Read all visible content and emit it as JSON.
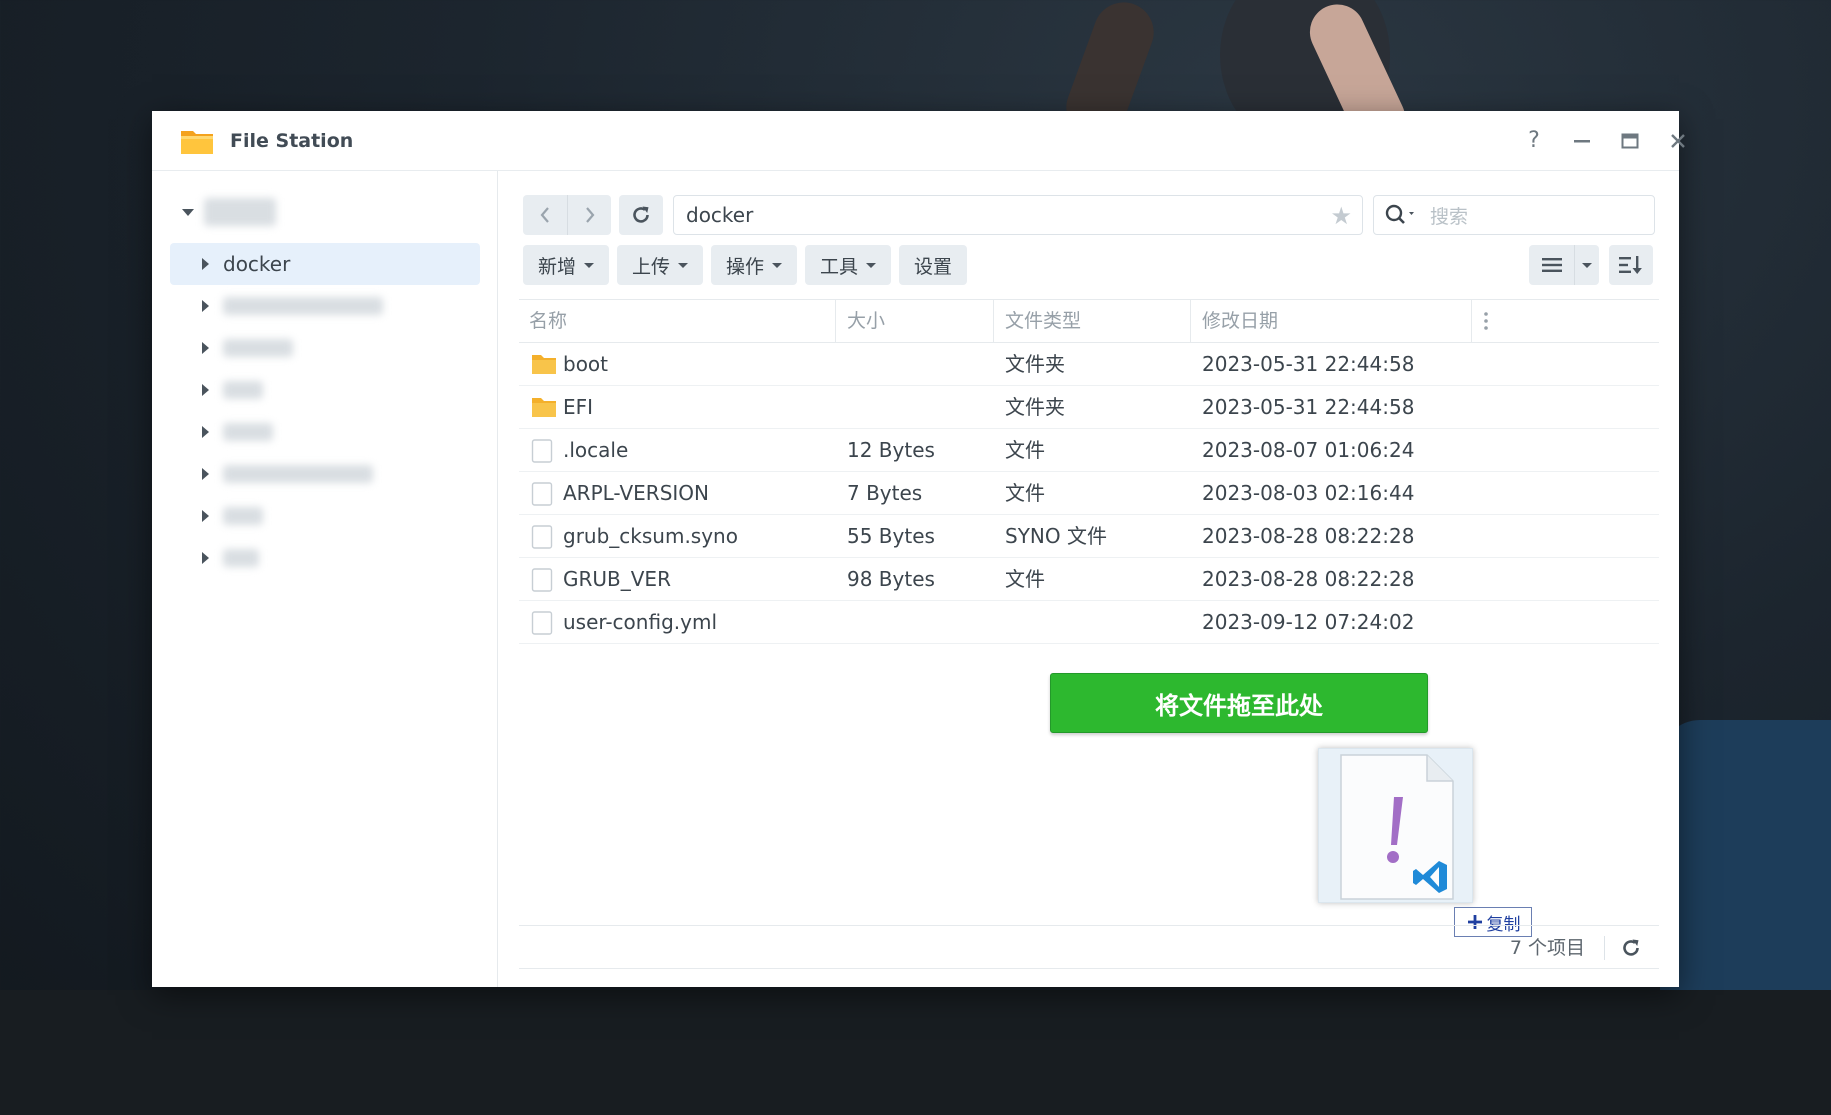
{
  "window": {
    "title": "File Station",
    "help_label": "?",
    "minimize_label": "—",
    "maximize_label": "□",
    "close_label": "✕"
  },
  "sidebar": {
    "selected_folder": "docker"
  },
  "path_bar": {
    "current_path": "docker"
  },
  "search": {
    "placeholder": "搜索"
  },
  "toolbar": {
    "new_label": "新增",
    "upload_label": "上传",
    "action_label": "操作",
    "tools_label": "工具",
    "settings_label": "设置"
  },
  "table": {
    "columns": [
      "名称",
      "大小",
      "文件类型",
      "修改日期"
    ],
    "rows": [
      {
        "name": "boot",
        "size": "",
        "type": "文件夹",
        "modified": "2023-05-31 22:44:58",
        "icon": "folder-icon"
      },
      {
        "name": "EFI",
        "size": "",
        "type": "文件夹",
        "modified": "2023-05-31 22:44:58",
        "icon": "folder-icon"
      },
      {
        "name": ".locale",
        "size": "12 Bytes",
        "type": "文件",
        "modified": "2023-08-07 01:06:24",
        "icon": "file-icon"
      },
      {
        "name": "ARPL-VERSION",
        "size": "7 Bytes",
        "type": "文件",
        "modified": "2023-08-03 02:16:44",
        "icon": "file-icon"
      },
      {
        "name": "grub_cksum.syno",
        "size": "55 Bytes",
        "type": "SYNO 文件",
        "modified": "2023-08-28 08:22:28",
        "icon": "file-icon"
      },
      {
        "name": "GRUB_VER",
        "size": "98 Bytes",
        "type": "文件",
        "modified": "2023-08-28 08:22:28",
        "icon": "file-icon"
      },
      {
        "name": "user-config.yml",
        "size": "",
        "type": "",
        "modified": "2023-09-12 07:24:02",
        "icon": "file-icon"
      }
    ]
  },
  "drop_overlay": {
    "banner_text": "将文件拖至此处",
    "copy_label": "复制"
  },
  "footer": {
    "item_count": "7 个项目"
  },
  "colors": {
    "drop_banner": "#2db82f",
    "folder": "#f8c44a",
    "selected_bg": "#e6f0fb"
  }
}
